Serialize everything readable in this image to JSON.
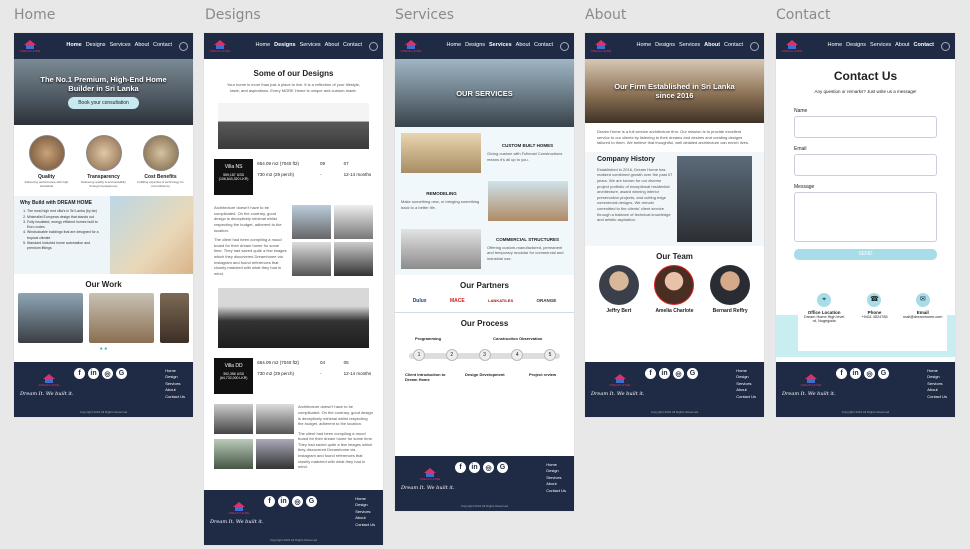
{
  "frames": {
    "home": "Home",
    "designs": "Designs",
    "services": "Services",
    "about": "About",
    "contact": "Contact"
  },
  "nav": {
    "home": "Home",
    "designs": "Designs",
    "services": "Services",
    "about": "About",
    "contact": "Contact"
  },
  "brand": "DREAM HOME",
  "footer": {
    "slogan": "Dream It. We built it.",
    "links": [
      "Home",
      "Design",
      "Services",
      "About",
      "Contact Us"
    ],
    "copyright": "Copyright 2024 All Rights Reserved"
  },
  "social": [
    "f",
    "in",
    "◎",
    "G"
  ],
  "home": {
    "hero_title": "The No.1 Premium, High-End Home Builder in Sri Lanka",
    "hero_button": "Book your consultation",
    "features": [
      {
        "title": "Quality",
        "desc": "Delivering performance with high standards"
      },
      {
        "title": "Transparency",
        "desc": "Delivering quality & accountability through transparency"
      },
      {
        "title": "Cost Benefits",
        "desc": "Fulfilling expertise & technology for cost efficiency"
      }
    ],
    "why_title": "Why Build with DREAM HOME",
    "why_list": [
      "The most high end villa's in Sri Lanka (by far)",
      "Minimalist European design that stands out",
      "Fully insulated, energy efficient homes built to Euro codes",
      "Windsolcable buildings that are designed for a tropical climate",
      "Standard included home automation and premium fittings"
    ],
    "work_title": "Our Work"
  },
  "designs": {
    "title": "Some of our Designs",
    "intro": "Your home is more than just a place to live. It is a reflection of your lifestyle, taste, and aspirations. Every MORE Home is unique and custom-made.",
    "villa1": {
      "name": "Villa NS",
      "price": "559,187 USD (106,843,320 LKR)",
      "area": "654.09 m2 (7040 ft2)",
      "floors": "09",
      "baths": "07",
      "size": "730 m2 (29 perch)",
      "dash": "-",
      "time": "12-14 months"
    },
    "villa2": {
      "name": "Villa DD",
      "price": "392,356 USD (64,732,000 LKR)",
      "area": "654.09 m2 (7040 ft2)",
      "floors": "04",
      "baths": "05",
      "size": "730 m2 (29 perch)",
      "dash": "-",
      "time": "12-14 months"
    },
    "para1": "Architecture doesn't have to be complicated. On the contrary, good design is deceptively minimal whilst respecting the budget, adherent to the location.",
    "para2": "The client had been compiling a mood board for their dream home for some time. They had saved quite a few images which they discovered Dreamhome via Instagram and found references that closely matched with what they had in mind."
  },
  "services": {
    "hero": "OUR SERVICES",
    "s1_title": "CUSTOM BUILT HOMES",
    "s1_desc": "Giving custom with Fullmost Constructions means it's all up to you.",
    "s2_title": "REMODELING",
    "s2_desc": "Make something new, or bringing something back to a better life.",
    "s3_title": "COMMERCIAL STRUCTURES",
    "s3_desc": "Offering custom-manufactured, permanent and temporary modular for commercial and industrial use.",
    "partners_title": "Our Partners",
    "partners": [
      "Dulux",
      "MACE",
      "LANKATILES",
      "ORANGE"
    ],
    "process_title": "Our Process",
    "process_top": [
      "Programming",
      "Construction Observation"
    ],
    "process_bottom": [
      "Client Introduction to Dream Home",
      "Design Development",
      "Project review"
    ],
    "steps": [
      "1",
      "2",
      "3",
      "4",
      "5"
    ]
  },
  "about": {
    "hero": "Our Firm Established in Sri Lanka since 2016",
    "intro": "Dream Home is a full service architecture firm. Our mission is to provide excellent service to our clients by listening to their dreams and desires and creating designs tailored to them. We believe that thoughtful, well detailed architecture can enrich lives.",
    "history_title": "Company History",
    "history": "Established in 2016, Dream Home has realized combined growth over the past 07 years. We are known for our diverse project portfolio of exceptional residential architecture, award winning interior preservation projects, and cutting edge commercial designs. We remain committed to the clients' client service through a balance of technical knowledge and artistic aspiration.",
    "team_title": "Our Team",
    "team": [
      "Jeffry Bert",
      "Amelia Charlote",
      "Bernard Reffry"
    ]
  },
  "contact": {
    "title": "Contact Us",
    "sub": "Any question or remarks? Just write us a message!",
    "name": "Name",
    "email": "Email",
    "message": "Message",
    "send": "SEND",
    "office_label": "Office Location",
    "office": "Dream Home High level rd, Nugegoda",
    "phone_label": "Phone",
    "phone": "+9411 4524785",
    "email_label": "Email",
    "email_val": "mail@dreamhome.com"
  }
}
